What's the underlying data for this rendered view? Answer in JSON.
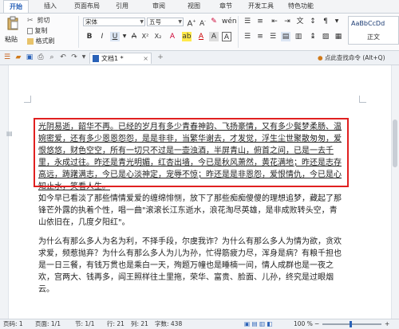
{
  "menu": {
    "tabs": [
      "开始",
      "插入",
      "页面布局",
      "引用",
      "审阅",
      "视图",
      "章节",
      "开发工具",
      "特色功能"
    ]
  },
  "ribbon": {
    "paste": "粘贴",
    "cut": "剪切",
    "copy": "复制",
    "format_painter": "格式刷",
    "font": "宋体",
    "font_size": "五号",
    "style_preview": "AaBbCcDd",
    "style_name": "正文"
  },
  "tabbar": {
    "doc_title": "文档1 *",
    "ad_text": "点此查找命令 (Alt+Q)"
  },
  "document": {
    "paragraphs": [
      "光阴易逝，韶华不再。已经的岁月有多少青春神韵、飞扬豪情，又有多少鬓梦柔肠、温婉密爱，还有多少恩恩怨怨，是是非非，当繁华谢去，才发觉，浮生尘世聚散匆匆，爱恨悠悠，财色空空，所有一切只不过是一壶浊酒，半屏青山，俯首之间，已是一去千里，永成过往。昨还是青光明媚，红杏出墙，今已是秋风萧然，黄花满地；昨还是志存高远，踌躇满志，今已是心淡神定，宠辱不惊；昨还是是非恩怨，爱恨情仇，今已是心知止水，笑看人生。",
      "如今早已看淡了那些情情爱爱的缠绵悱恻，放下了那些痴痴傻傻的理想追梦，藏起了那锋芒外露的执着个性，唱一曲\"滚滚长江东逝水，浪花淘尽英雄，是非成败转头空，青山依旧在，几度夕阳红\"。",
      "为什么有那么多人为名为利，不择手段，尔虞我诈？为什么有那么多人为情为欲，贪欢求爱，频惹抛弃？为什么有那么多人为儿为孙，忙得筋疲力尽，浑身是病？有粮千担也是一日三餐，有钱万贯也是乘白一天，殉题万幢也是睡楠一间，情人成群也是一夜之欢，宫两大、钱再多，阎王照样往土里拖，荣华、富贵、脸面、儿孙，终究是过眼烟云。"
    ]
  },
  "status": {
    "page": "页码: 1",
    "pages": "页面: 1/1",
    "section": "节: 1/1",
    "row": "行: 21",
    "col": "列: 21",
    "words": "字数: 438",
    "zoom": "100 %"
  },
  "colors": {
    "highlight_box": "#e02020",
    "active_tab": "#2a62b8"
  }
}
